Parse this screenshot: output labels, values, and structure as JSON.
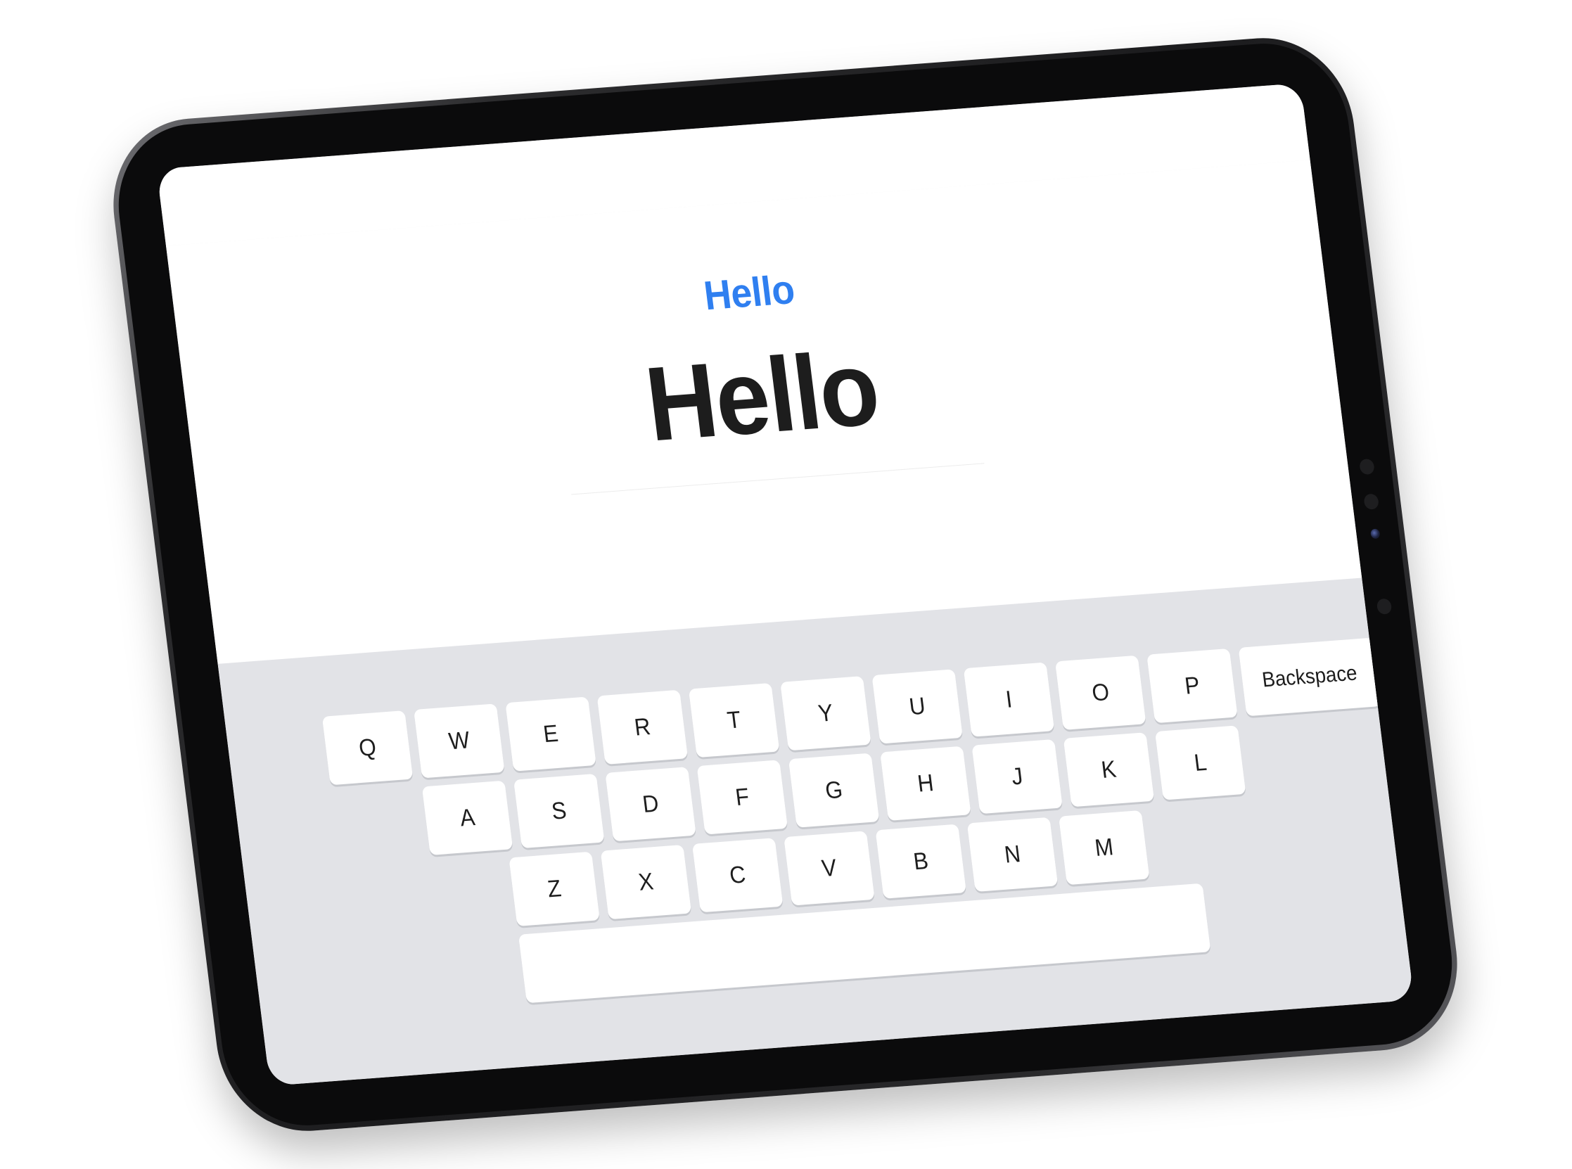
{
  "prompt": {
    "target_word": "Hello",
    "typed_text": "Hello"
  },
  "keyboard": {
    "row1": [
      "Q",
      "W",
      "E",
      "R",
      "T",
      "Y",
      "U",
      "I",
      "O",
      "P"
    ],
    "backspace_label": "Backspace",
    "row2": [
      "A",
      "S",
      "D",
      "F",
      "G",
      "H",
      "J",
      "K",
      "L"
    ],
    "row3": [
      "Z",
      "X",
      "C",
      "V",
      "B",
      "N",
      "M"
    ],
    "space_label": ""
  },
  "colors": {
    "accent": "#2f7ff0",
    "text": "#1d1d1d",
    "keyboard_bg": "#e2e3e7",
    "key_bg": "#ffffff"
  }
}
